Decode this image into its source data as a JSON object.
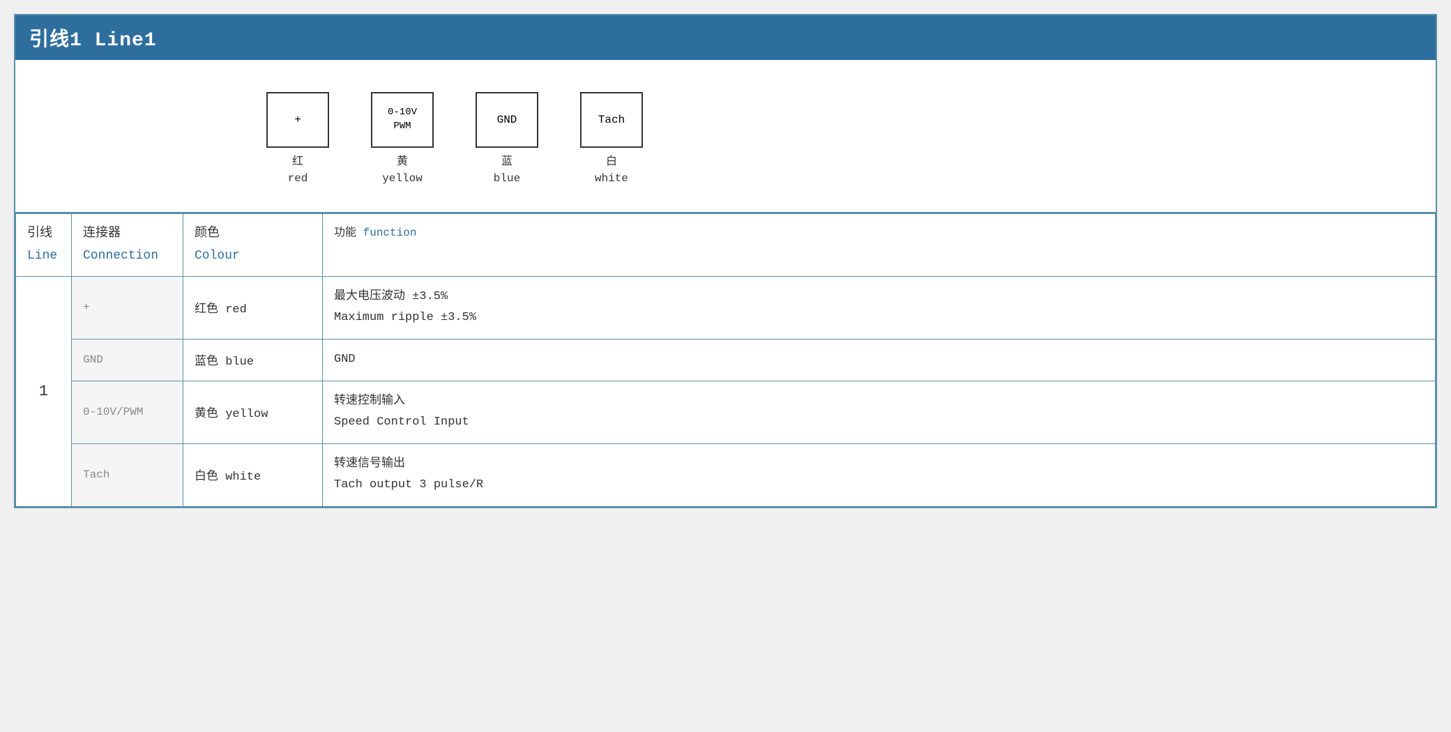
{
  "title": "引线1 Line1",
  "diagram": {
    "connectors": [
      {
        "symbol": "+",
        "zh_label": "红",
        "en_label": "red"
      },
      {
        "symbol": "0-10V\nPWM",
        "zh_label": "黄",
        "en_label": "yellow"
      },
      {
        "symbol": "GND",
        "zh_label": "蓝",
        "en_label": "blue"
      },
      {
        "symbol": "Tach",
        "zh_label": "白",
        "en_label": "white"
      }
    ]
  },
  "table": {
    "headers": {
      "line_zh": "引线",
      "line_en": "Line",
      "connection_zh": "连接器",
      "connection_en": "Connection",
      "colour_zh": "颜色",
      "colour_en": "Colour",
      "function_zh": "功能",
      "function_en": "function"
    },
    "rows": [
      {
        "line_number": "1",
        "connection": "+",
        "colour": "红色 red",
        "func_zh": "最大电压波动 ±3.5%",
        "func_en": "Maximum ripple ±3.5%"
      },
      {
        "line_number": "",
        "connection": "GND",
        "colour": "蓝色 blue",
        "func_zh": "GND",
        "func_en": ""
      },
      {
        "line_number": "",
        "connection": "0-10V/PWM",
        "colour": "黄色 yellow",
        "func_zh": "转速控制输入",
        "func_en": "Speed Control Input"
      },
      {
        "line_number": "",
        "connection": "Tach",
        "colour": "白色 white",
        "func_zh": "转速信号输出",
        "func_en": "Tach output 3 pulse/R"
      }
    ]
  }
}
